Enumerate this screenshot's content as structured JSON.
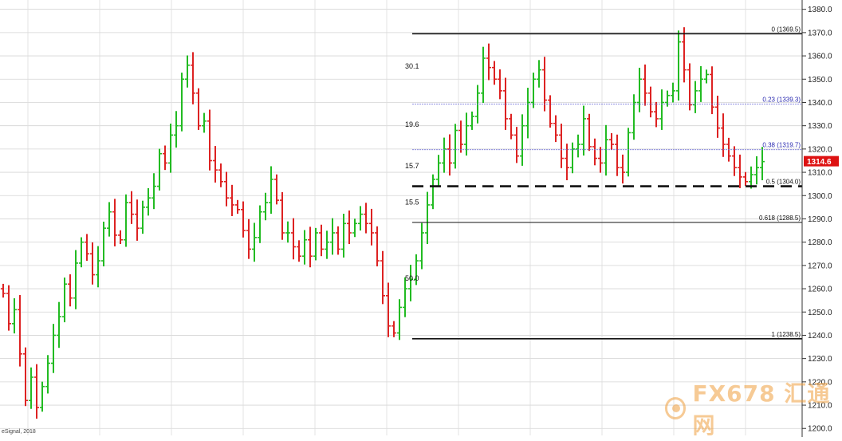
{
  "chart_data": {
    "type": "ohlc-bar",
    "title": "",
    "xlabel": "",
    "ylabel": "",
    "ylim": [
      1197,
      1384
    ],
    "y_ticks": [
      1200,
      1210,
      1220,
      1230,
      1240,
      1250,
      1260,
      1270,
      1280,
      1290,
      1300,
      1310,
      1320,
      1330,
      1340,
      1350,
      1360,
      1370,
      1380
    ],
    "y_tick_labels": [
      "1200.0",
      "1210.0",
      "1220.0",
      "1230.0",
      "1240.0",
      "1250.0",
      "1260.0",
      "1270.0",
      "1280.0",
      "1290.0",
      "1300.0",
      "1310.0",
      "1320.0",
      "1330.0",
      "1340.0",
      "1350.0",
      "1360.0",
      "1370.0",
      "1380.0"
    ],
    "grid": true,
    "up_color": "#22bb22",
    "down_color": "#dd2222",
    "last_price": {
      "value": 1314.6,
      "label": "1314.6",
      "color": "#dd1111"
    },
    "close_path": [
      1258,
      1245,
      1251,
      1232,
      1212,
      1222,
      1209,
      1218,
      1228,
      1240,
      1248,
      1262,
      1256,
      1271,
      1280,
      1275,
      1266,
      1272,
      1286,
      1293,
      1283,
      1281,
      1297,
      1292,
      1286,
      1295,
      1299,
      1304,
      1318,
      1314,
      1326,
      1330,
      1350,
      1356,
      1344,
      1330,
      1332,
      1315,
      1311,
      1306,
      1299,
      1296,
      1294,
      1285,
      1277,
      1282,
      1293,
      1297,
      1307,
      1298,
      1284,
      1284,
      1278,
      1274,
      1281,
      1274,
      1284,
      1277,
      1280,
      1284,
      1277,
      1288,
      1284,
      1288,
      1292,
      1288,
      1284,
      1272,
      1257,
      1244,
      1241,
      1252,
      1260,
      1264,
      1272,
      1284,
      1296,
      1307,
      1314,
      1320,
      1314,
      1328,
      1322,
      1330,
      1334,
      1344,
      1359,
      1355,
      1350,
      1345,
      1333,
      1326,
      1317,
      1330,
      1340,
      1350,
      1354,
      1341,
      1331,
      1326,
      1316,
      1312,
      1320,
      1322,
      1333,
      1321,
      1316,
      1314,
      1324,
      1322,
      1312,
      1310,
      1327,
      1340,
      1350,
      1344,
      1336,
      1333,
      1340,
      1343,
      1345,
      1366,
      1354,
      1339,
      1345,
      1350,
      1352,
      1338,
      1329,
      1322,
      1317,
      1312,
      1308,
      1306,
      1309,
      1312,
      1314.6
    ],
    "fibonacci": {
      "levels": [
        {
          "ratio": "0",
          "value": 1369.5,
          "label": "0 (1369.5)",
          "style": "solid"
        },
        {
          "ratio": "0.23",
          "value": 1339.3,
          "label": "0.23 (1339.3)",
          "style": "dotted"
        },
        {
          "ratio": "0.38",
          "value": 1319.7,
          "label": "0.38 (1319.7)",
          "style": "dotted"
        },
        {
          "ratio": "0.5",
          "value": 1304.0,
          "label": "0.5 (1304.0)",
          "style": "dashed"
        },
        {
          "ratio": "0.618",
          "value": 1288.5,
          "label": "0.618 (1288.5)",
          "style": "solid"
        },
        {
          "ratio": "1",
          "value": 1238.5,
          "label": "1 (1238.5)",
          "style": "solid"
        }
      ],
      "zone_labels": [
        {
          "text": "30.1",
          "value": 1354.5
        },
        {
          "text": "19.6",
          "value": 1329.5
        },
        {
          "text": "15.7",
          "value": 1311.8
        },
        {
          "text": "15.5",
          "value": 1296.2
        },
        {
          "text": "50.0",
          "value": 1263.5
        }
      ]
    },
    "watermark": "FX678 汇通网",
    "credit": "eSignal, 2018"
  }
}
